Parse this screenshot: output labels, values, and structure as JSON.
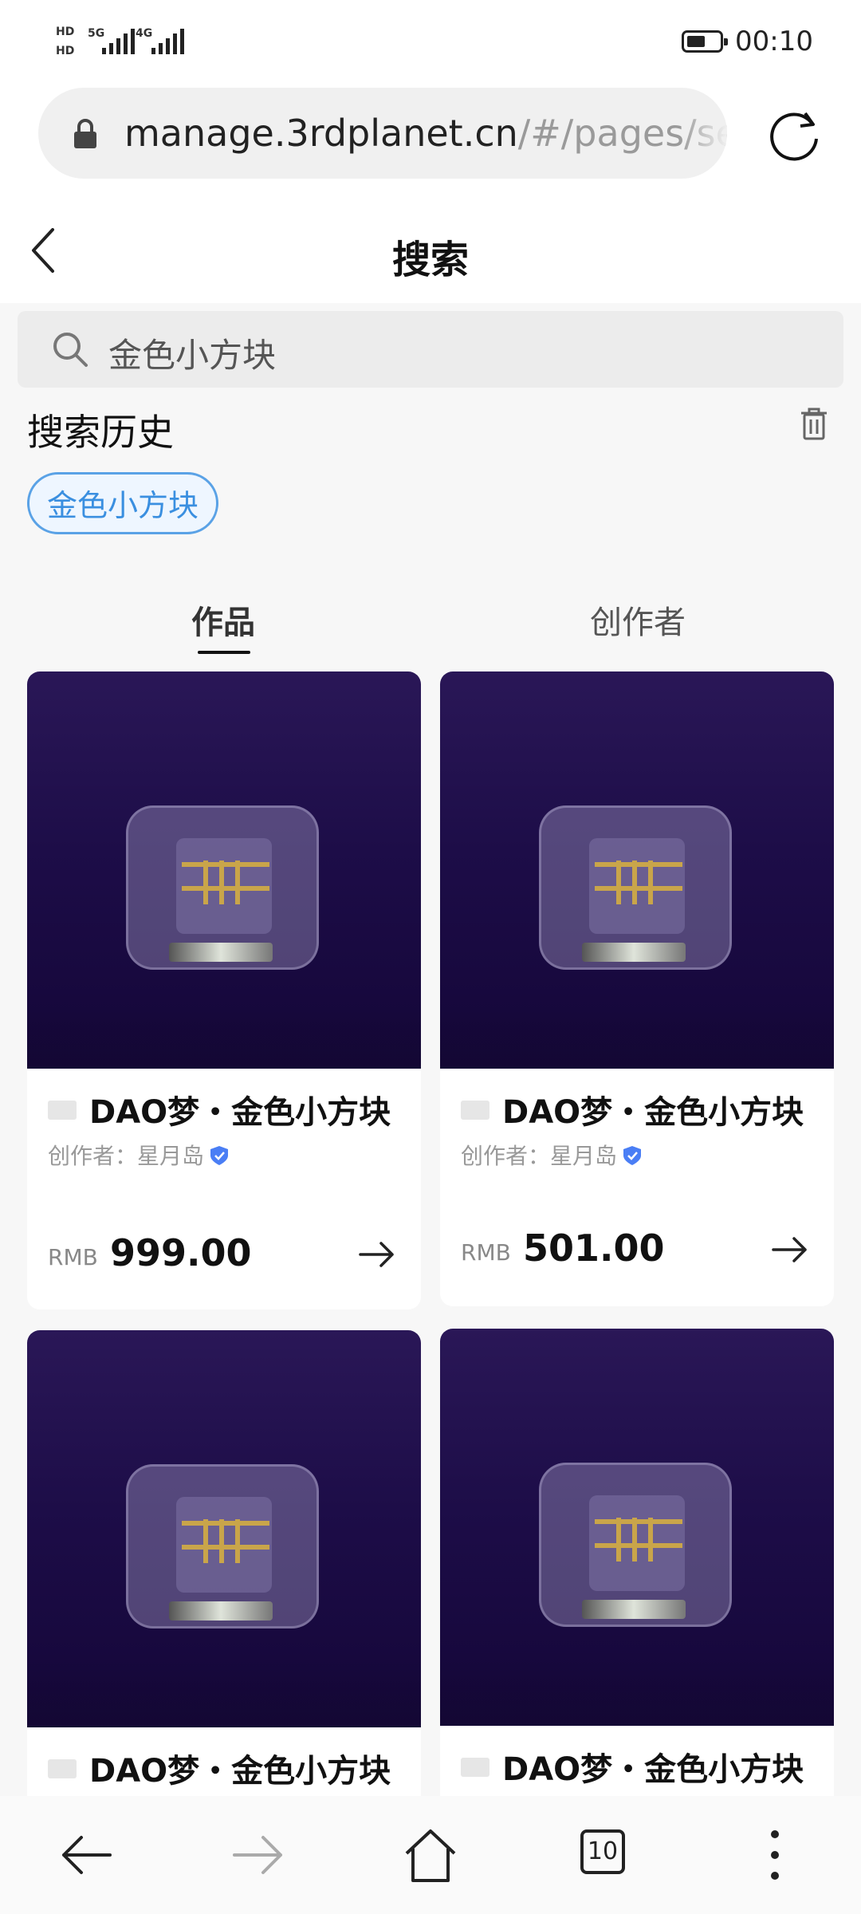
{
  "status_bar": {
    "sim1_net": "5G",
    "sim2_net": "4G",
    "time": "00:10"
  },
  "browser": {
    "url_domain": "manage.3rdplanet.cn",
    "url_path": "/#/pages/sea",
    "tab_count": "10"
  },
  "header": {
    "title": "搜索"
  },
  "search": {
    "query": "金色小方块"
  },
  "history": {
    "title": "搜索历史",
    "tags": [
      "金色小方块"
    ]
  },
  "tabs": [
    {
      "label": "作品",
      "active": true
    },
    {
      "label": "创作者",
      "active": false
    }
  ],
  "cards": [
    {
      "title": "DAO梦・金色小方块",
      "creator": "创作者：星月岛",
      "currency": "RMB",
      "price": "999.00"
    },
    {
      "title": "DAO梦・金色小方块",
      "creator": "创作者：星月岛",
      "currency": "RMB",
      "price": "501.00"
    },
    {
      "title": "DAO梦・金色小方块",
      "creator": "",
      "currency": "",
      "price": ""
    },
    {
      "title": "DAO梦・金色小方块",
      "creator": "",
      "currency": "",
      "price": ""
    }
  ],
  "colors": {
    "accent_blue": "#3a8fe0",
    "card_bg_dark": "#1d0d48",
    "page_bg": "#f7f7f7"
  }
}
